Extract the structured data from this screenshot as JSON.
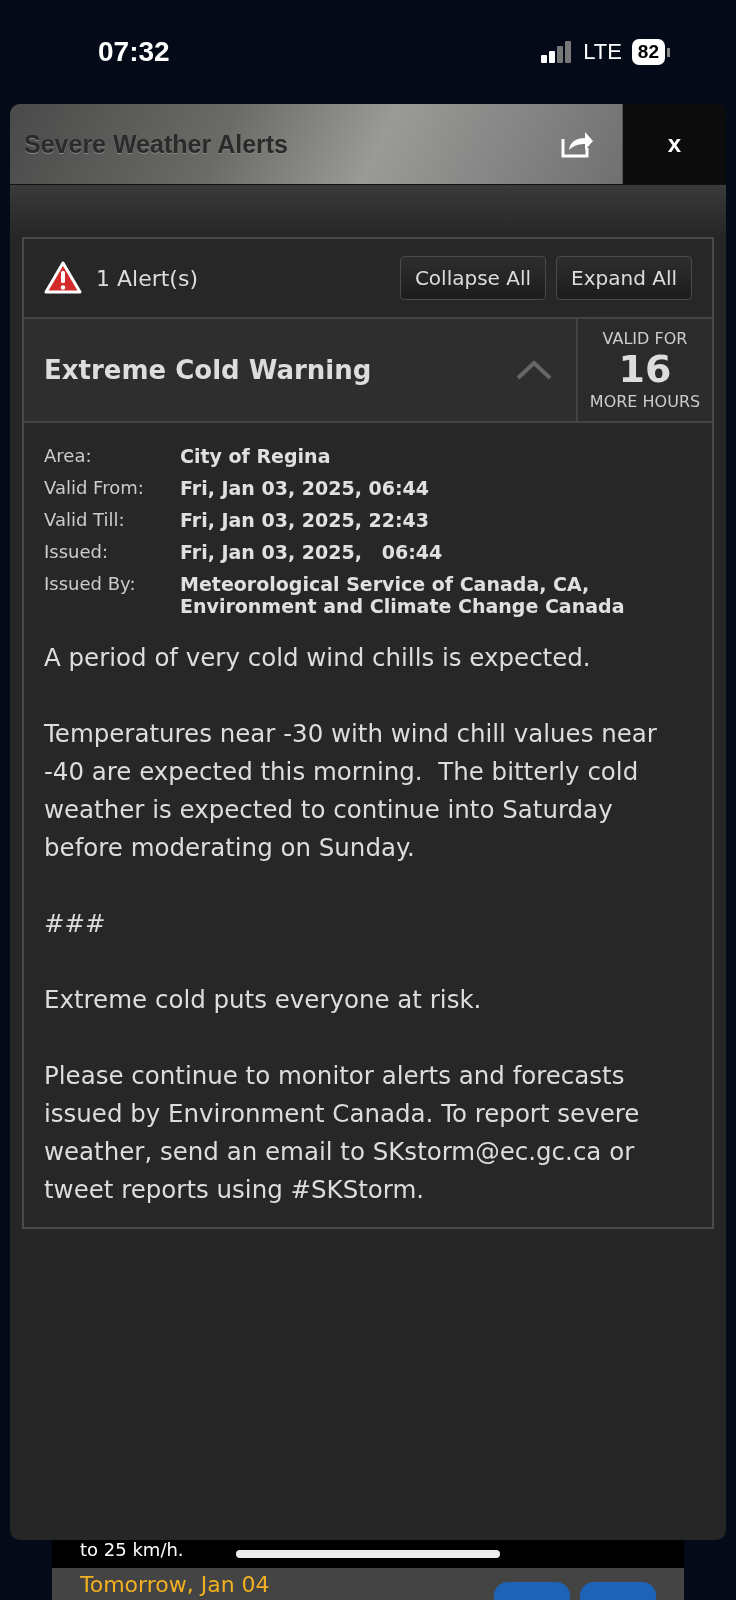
{
  "status_bar": {
    "time": "07:32",
    "network": "LTE",
    "battery": "82"
  },
  "modal": {
    "title": "Severe Weather Alerts",
    "close": "x",
    "summary": {
      "count": "1 Alert(s)",
      "buttons": [
        "Collapse All",
        "Expand All"
      ]
    },
    "alerts": [
      {
        "title": "Extreme Cold Warning",
        "expanded": true,
        "valid_for": {
          "top": "VALID FOR",
          "number": "16",
          "bottom": "MORE HOURS"
        },
        "details": [
          {
            "label": "Area:",
            "value": "City of Regina"
          },
          {
            "label": "Valid From:",
            "value": "Fri, Jan 03, 2025, 06:44"
          },
          {
            "label": "Valid Till:",
            "value": "Fri, Jan 03, 2025, 22:43"
          },
          {
            "label": "Issued:",
            "value": "Fri, Jan 03, 2025,   06:44"
          },
          {
            "label": "Issued By:",
            "value": "Meteorological Service of Canada, CA, Environment and Climate Change Canada"
          }
        ],
        "paragraphs": [
          "A period of very cold wind chills is expected.",
          "Temperatures near -30 with wind chill values near -40 are expected this morning.  The bitterly cold weather is expected to continue into Saturday before moderating on Sunday.",
          "###",
          "Extreme cold puts everyone at risk.",
          "Please continue to monitor alerts and forecasts issued by Environment Canada. To report severe weather, send an email to SKstorm@ec.gc.ca or tweet reports using #SKStorm."
        ]
      }
    ]
  },
  "background": {
    "text": "to 25 km/h.",
    "date": "Tomorrow, Jan 04"
  }
}
